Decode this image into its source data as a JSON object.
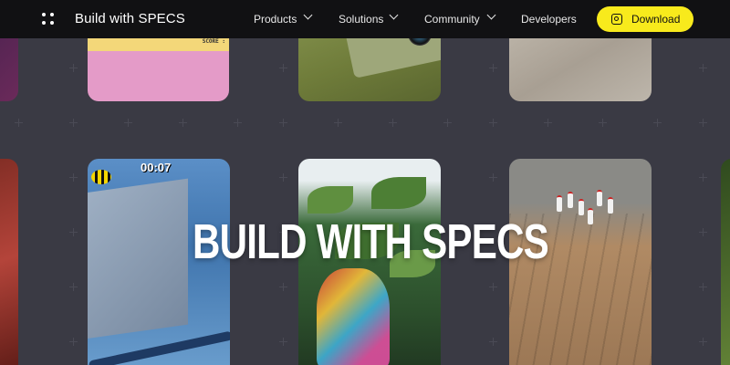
{
  "header": {
    "brand": "Build with SPECS",
    "nav": [
      {
        "label": "Products",
        "has_dropdown": true
      },
      {
        "label": "Solutions",
        "has_dropdown": true
      },
      {
        "label": "Community",
        "has_dropdown": true
      },
      {
        "label": "Developers",
        "has_dropdown": false
      }
    ],
    "download_label": "Download",
    "download_color": "#f8ea1c",
    "menu_icon": "grid-dots-icon",
    "download_icon": "specs-glasses-icon"
  },
  "hero": {
    "title": "BUILD WITH SPECS"
  },
  "gallery": {
    "cards": [
      {
        "name": "card-arcade-game",
        "score_label": "SCORE :"
      },
      {
        "name": "card-camera-object"
      },
      {
        "name": "card-floor-tiles"
      },
      {
        "name": "card-underwater-game",
        "timer": "00:07"
      },
      {
        "name": "card-ar-deer-plants"
      },
      {
        "name": "card-ar-bowling"
      }
    ]
  },
  "colors": {
    "background": "#1c1c22",
    "nav_background": "#111113",
    "accent": "#f8ea1c"
  }
}
